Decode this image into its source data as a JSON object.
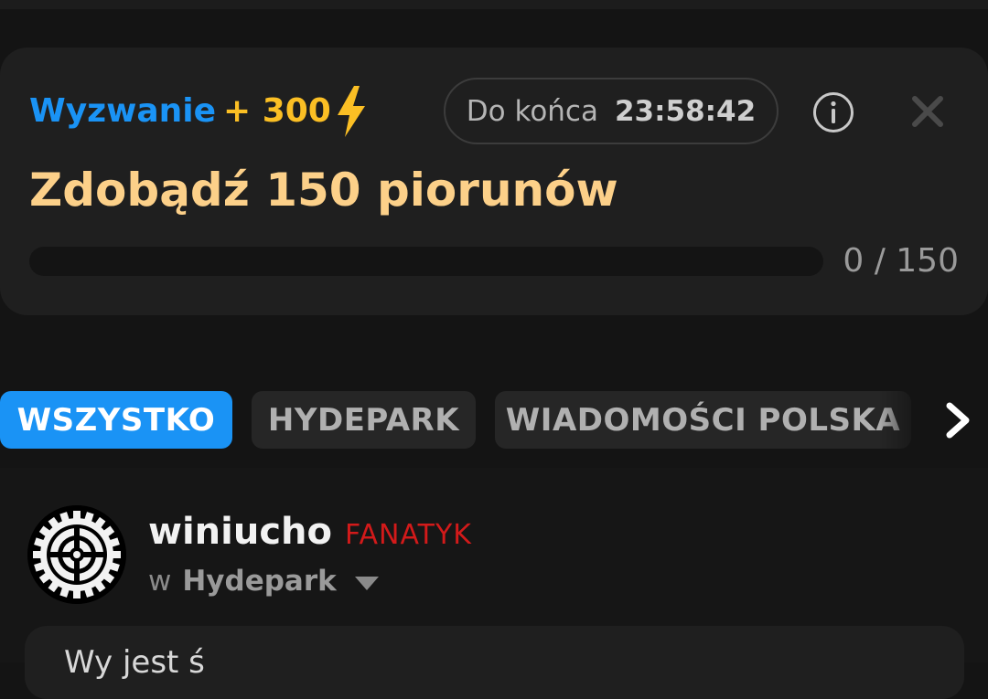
{
  "challenge": {
    "label": "Wyzwanie",
    "points": "+ 300",
    "points_icon": "bolt-icon",
    "timer_label": "Do końca",
    "timer_value": "23:58:42",
    "title": "Zdobądź 150 piorunów",
    "progress_current": 0,
    "progress_total": 150,
    "progress_text": "0 / 150",
    "info_icon": "info-icon",
    "close_icon": "close-icon"
  },
  "tabs": [
    {
      "label": "WSZYSTKO",
      "active": true
    },
    {
      "label": "HYDEPARK",
      "active": false
    },
    {
      "label": "WIADOMOŚCI POLSKA",
      "active": false
    }
  ],
  "tabs_next_icon": "chevron-right-icon",
  "post": {
    "username": "winiucho",
    "rank": "FANATYK",
    "community_prefix": "w",
    "community": "Hydepark",
    "text": "Wy jest ś"
  },
  "colors": {
    "accent_blue": "#1a93f5",
    "gold": "#fbbf24",
    "title_gold": "#fcd089",
    "rank_red": "#d21a1a",
    "background": "#141414",
    "card": "#1f1f1f"
  }
}
